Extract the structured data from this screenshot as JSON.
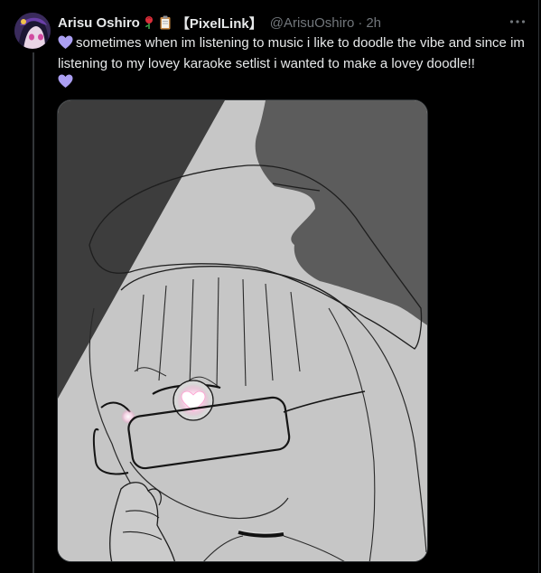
{
  "tweet": {
    "display_name": "Arisu Oshiro",
    "badge_text": "【PixelLink】",
    "handle": "@ArisuOshiro",
    "separator": "·",
    "time": "2h",
    "text": "sometimes when im listening to music i like to doodle the vibe and since im listening to my lovey karaoke setlist i wanted to make a lovey doodle!!",
    "emoji_icons": [
      "purple-heart-icon",
      "rose-icon",
      "clipboard-icon"
    ]
  },
  "colors": {
    "background": "#000000",
    "text_primary": "#e7e9ea",
    "text_secondary": "#71767b",
    "border": "#2f3336",
    "purple_heart": "#ab9ff2"
  }
}
